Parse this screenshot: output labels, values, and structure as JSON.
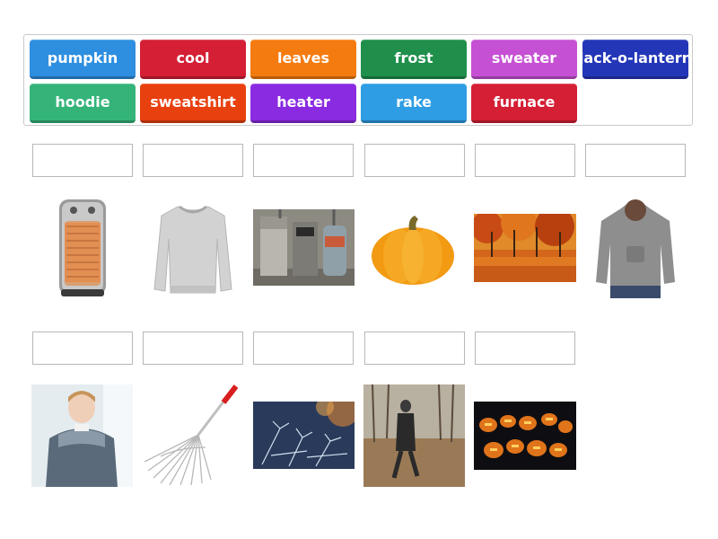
{
  "word_bank": [
    {
      "label": "pumpkin",
      "color": "#2e8fe0"
    },
    {
      "label": "cool",
      "color": "#d41f35"
    },
    {
      "label": "leaves",
      "color": "#f47b10"
    },
    {
      "label": "frost",
      "color": "#1f8f4b"
    },
    {
      "label": "sweater",
      "color": "#c650d4"
    },
    {
      "label": "jack-o-lantern",
      "color": "#2436b8"
    },
    {
      "label": "hoodie",
      "color": "#35b47a"
    },
    {
      "label": "sweatshirt",
      "color": "#e8400f"
    },
    {
      "label": "heater",
      "color": "#8a2be2"
    },
    {
      "label": "rake",
      "color": "#2e9de3"
    },
    {
      "label": "furnace",
      "color": "#d41f35"
    }
  ],
  "row1_pictures": [
    "space-heater",
    "gray-sweatshirt",
    "furnace-room",
    "orange-pumpkin",
    "autumn-forest",
    "gray-hoodie"
  ],
  "row2_pictures": [
    "boy-in-sweater",
    "leaf-rake",
    "frost-crystals",
    "person-walking-on-leaves",
    "jack-o-lanterns"
  ]
}
